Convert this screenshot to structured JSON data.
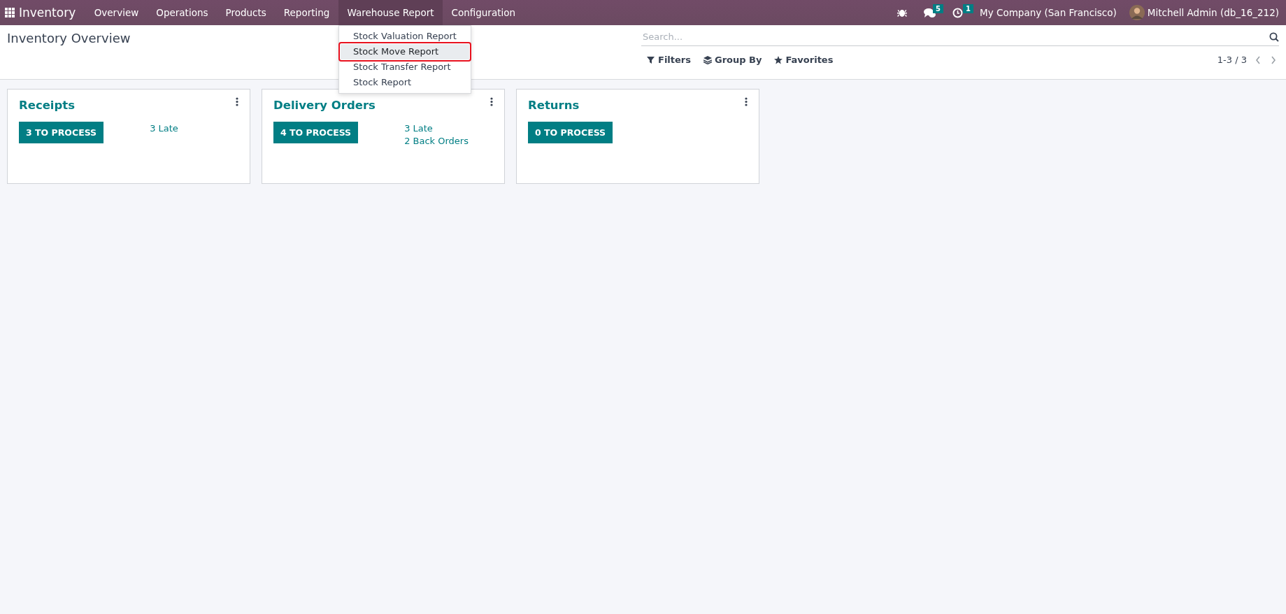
{
  "navbar": {
    "app_name": "Inventory",
    "menu": [
      {
        "label": "Overview",
        "selected": false
      },
      {
        "label": "Operations",
        "selected": false
      },
      {
        "label": "Products",
        "selected": false
      },
      {
        "label": "Reporting",
        "selected": false
      },
      {
        "label": "Warehouse Report",
        "selected": true
      },
      {
        "label": "Configuration",
        "selected": false
      }
    ],
    "messages_badge": "5",
    "activities_badge": "1",
    "company": "My Company (San Francisco)",
    "user": "Mitchell Admin (db_16_212)"
  },
  "dropdown": {
    "items": [
      {
        "label": "Stock Valuation Report",
        "selected": false
      },
      {
        "label": "Stock Move Report",
        "selected": true
      },
      {
        "label": "Stock Transfer Report",
        "selected": false
      },
      {
        "label": "Stock Report",
        "selected": false
      }
    ]
  },
  "control_panel": {
    "title": "Inventory Overview",
    "search": {
      "placeholder": "Search..."
    },
    "filters": [
      "Filters",
      "Group By",
      "Favorites"
    ],
    "pager": "1-3 / 3"
  },
  "cards": [
    {
      "title": "Receipts",
      "button": "3 TO PROCESS",
      "links": [
        "3 Late"
      ]
    },
    {
      "title": "Delivery Orders",
      "button": "4 TO PROCESS",
      "links": [
        "3 Late",
        "2 Back Orders"
      ]
    },
    {
      "title": "Returns",
      "button": "0 TO PROCESS"
    }
  ]
}
